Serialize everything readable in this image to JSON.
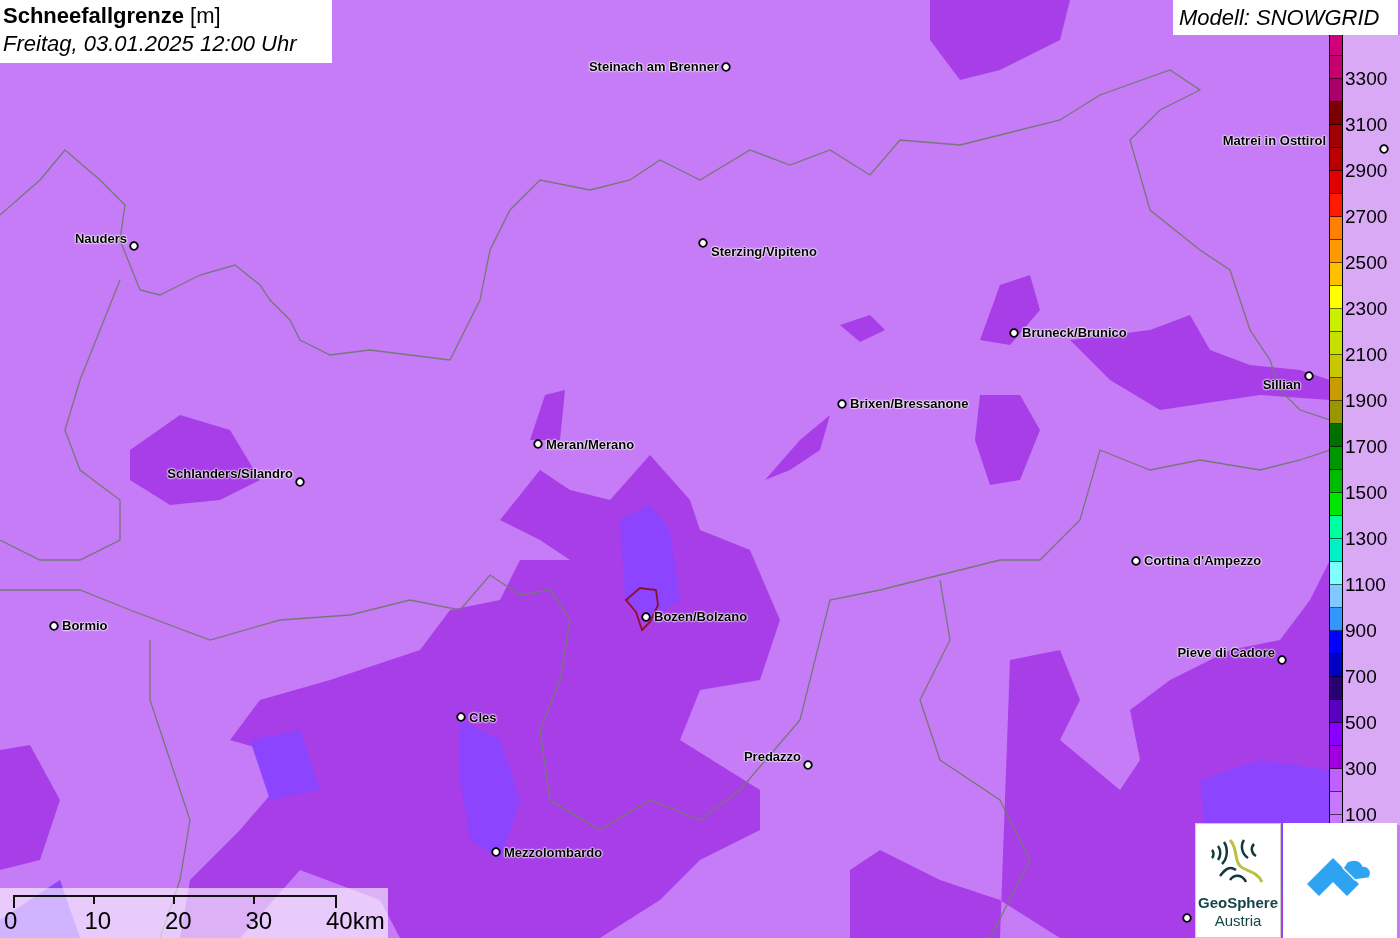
{
  "title": {
    "heading": "**Schneefallgrenze** [m]",
    "datetime": "Freitag, 03.01.2025 12:00 Uhr"
  },
  "model": "Modell: SNOWGRID",
  "cities": [
    {
      "name": "Steinach am Brenner"
    },
    {
      "name": "Matrei in Osttirol"
    },
    {
      "name": "Nauders"
    },
    {
      "name": "Sterzing/Vipiteno"
    },
    {
      "name": "Bruneck/Brunico"
    },
    {
      "name": "Sillian"
    },
    {
      "name": "Brixen/Bressanone"
    },
    {
      "name": "Meran/Merano"
    },
    {
      "name": "Schlanders/Silandro"
    },
    {
      "name": "Cortina d'Ampezzo"
    },
    {
      "name": "Bormio"
    },
    {
      "name": "Bozen/Bolzano"
    },
    {
      "name": "Pieve di Cadore"
    },
    {
      "name": "Cles"
    },
    {
      "name": "Predazzo"
    },
    {
      "name": "Mezzolombardo"
    }
  ],
  "legend": {
    "labels": [
      "3300",
      "3100",
      "2900",
      "2700",
      "2500",
      "2300",
      "2100",
      "1900",
      "1700",
      "1500",
      "1300",
      "1100",
      "900",
      "700",
      "500",
      "300",
      "100"
    ],
    "bins": [
      {
        "color": "#d0007a"
      },
      {
        "color": "#c8006e"
      },
      {
        "color": "#a80068"
      },
      {
        "color": "#7a0000"
      },
      {
        "color": "#a00000"
      },
      {
        "color": "#b80000"
      },
      {
        "color": "#e00000"
      },
      {
        "color": "#ff1a00"
      },
      {
        "color": "#ff7f00"
      },
      {
        "color": "#ff9900"
      },
      {
        "color": "#ffc000"
      },
      {
        "color": "#ffff00"
      },
      {
        "color": "#c8f000"
      },
      {
        "color": "#c8e000"
      },
      {
        "color": "#c8c800"
      },
      {
        "color": "#c89b00"
      },
      {
        "color": "#9a9600"
      },
      {
        "color": "#006f00"
      },
      {
        "color": "#009600"
      },
      {
        "color": "#00bb00"
      },
      {
        "color": "#00e600"
      },
      {
        "color": "#00ff9f"
      },
      {
        "color": "#00f0c8"
      },
      {
        "color": "#80ffff"
      },
      {
        "color": "#80c8ff"
      },
      {
        "color": "#3296ff"
      },
      {
        "color": "#0000ff"
      },
      {
        "color": "#0000c0"
      },
      {
        "color": "#2a0070"
      },
      {
        "color": "#5a00c0"
      },
      {
        "color": "#8a00ff"
      },
      {
        "color": "#a000e0"
      },
      {
        "color": "#c060ff"
      },
      {
        "color": "#c878ff"
      },
      {
        "color": "#c878ff"
      }
    ]
  },
  "scale_bar": {
    "labels": [
      "0",
      "10",
      "20",
      "30",
      "40km"
    ]
  },
  "logo": {
    "name": "GeoSphere",
    "subtitle": "Austria"
  }
}
